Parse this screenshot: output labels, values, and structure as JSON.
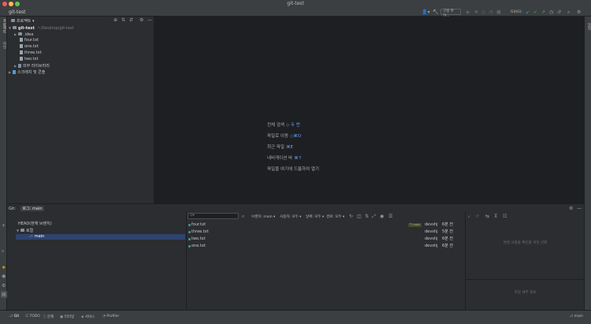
{
  "window": {
    "title": "git-test"
  },
  "navbar": {
    "project": "git-test",
    "config_label": "구성 추가...",
    "git_label": "Git(G):"
  },
  "left_strip": {
    "project_label": "프로젝트",
    "commit_label": "커밋"
  },
  "project_panel": {
    "title": "프로젝트",
    "root_name": "git-test",
    "root_path": "~/Desktop/git-test",
    "items": [
      {
        "label": ".idea",
        "kind": "folder"
      },
      {
        "label": "four.txt",
        "kind": "file"
      },
      {
        "label": "one.txt",
        "kind": "file"
      },
      {
        "label": "three.txt",
        "kind": "file"
      },
      {
        "label": "two.txt",
        "kind": "file"
      }
    ],
    "external_libs": "외부 라이브러리",
    "scratches": "스크래치 및 콘솔"
  },
  "editor": {
    "hints": [
      {
        "label": "전체 검색",
        "key": "◇ 두 번"
      },
      {
        "label": "파일로 이동",
        "key": "◇⌘O"
      },
      {
        "label": "최근 파일",
        "key": "⌘E"
      },
      {
        "label": "내비게이션 바",
        "key": "⌘↑"
      },
      {
        "label": "파일을 여기에 드롭하여 열기",
        "key": ""
      }
    ]
  },
  "git_panel": {
    "tab_git": "Git:",
    "tab_log": "로그: main",
    "branches": {
      "head": "HEAD(현재 브랜치)",
      "local_group": "로컬",
      "local_branch": "main"
    },
    "filter_placeholder": "Q▾",
    "filters": [
      "브랜치: main ▾",
      "사용자: 모두 ▾",
      "날짜: 모두 ▾",
      "경로: 모두 ▾"
    ],
    "branch_tag": "main",
    "commits": [
      {
        "message": "four.txt",
        "author": "devshj",
        "date": "6분 전"
      },
      {
        "message": "three.txt",
        "author": "devshj",
        "date": "5분 전"
      },
      {
        "message": "two.txt",
        "author": "devshj",
        "date": "6분 전"
      },
      {
        "message": "one.txt",
        "author": "devshj",
        "date": "6분 전"
      }
    ],
    "detail_empty": "변경 사항을 확인할 커밋 선택",
    "detail_info": "커밋 세부 정보"
  },
  "right_strip": {
    "label": "알림"
  },
  "status_bar": {
    "tabs": [
      "Git",
      "TODO",
      "문제",
      "터미널",
      "서비스",
      "Profiler"
    ],
    "branch": "main"
  }
}
